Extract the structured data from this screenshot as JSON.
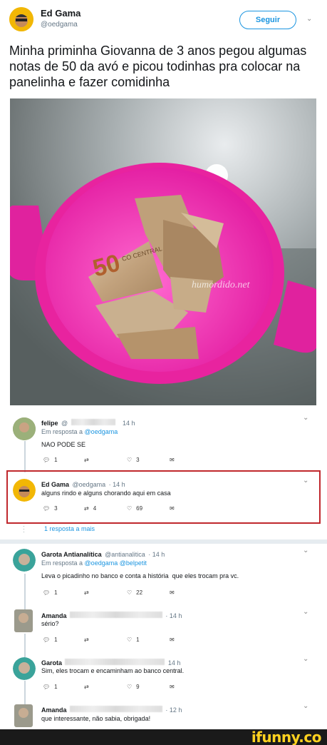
{
  "main_tweet": {
    "name": "Ed Gama",
    "handle": "@oedgama",
    "follow_label": "Seguir",
    "text": "Minha priminha Giovanna de 3 anos pegou algumas notas de 50 da avó e picou todinhas pra colocar na panelinha e fazer comidinha",
    "watermark": "humordido.net"
  },
  "replies": [
    {
      "name": "felipe",
      "handle": "@",
      "time": "14 h",
      "reply_to_prefix": "Em resposta a",
      "reply_to": "@oedgama",
      "text": "NAO PODE SE",
      "replies_count": "1",
      "retweets_count": "",
      "likes_count": "3"
    },
    {
      "name": "Ed Gama",
      "handle": "@oedgama",
      "time": "· 14 h",
      "text": "alguns rindo e alguns chorando aqui em casa",
      "replies_count": "3",
      "retweets_count": "4",
      "likes_count": "69"
    },
    {
      "more_replies": "1 resposta a mais"
    },
    {
      "name": "Garota Antianalítica",
      "handle": "@antianalitica",
      "time": "· 14 h",
      "reply_to_prefix": "Em resposta a",
      "reply_to": "@oedgama @belpetit",
      "text": "Leva o picadinho no banco e conta a história  que eles trocam pra vc.",
      "replies_count": "1",
      "retweets_count": "",
      "likes_count": "22"
    },
    {
      "name": "Amanda",
      "time": "· 14 h",
      "text": "sério?",
      "replies_count": "1",
      "retweets_count": "",
      "likes_count": "1"
    },
    {
      "name": "Garota",
      "time": "14 h",
      "text": "Sim, eles trocam e encaminham ao banco central.",
      "replies_count": "1",
      "retweets_count": "",
      "likes_count": "9"
    },
    {
      "name": "Amanda",
      "time": "· 12 h",
      "text": "que interessante, não sabia, obrigada!"
    }
  ],
  "footer": {
    "brand": "ifunny.co"
  },
  "colors": {
    "link_blue": "#1b95e0",
    "highlight_border": "#c0282d",
    "bowl_pink": "#e81f9c",
    "footer_bg": "#1a1a1a",
    "brand_yellow": "#ffd21f"
  }
}
